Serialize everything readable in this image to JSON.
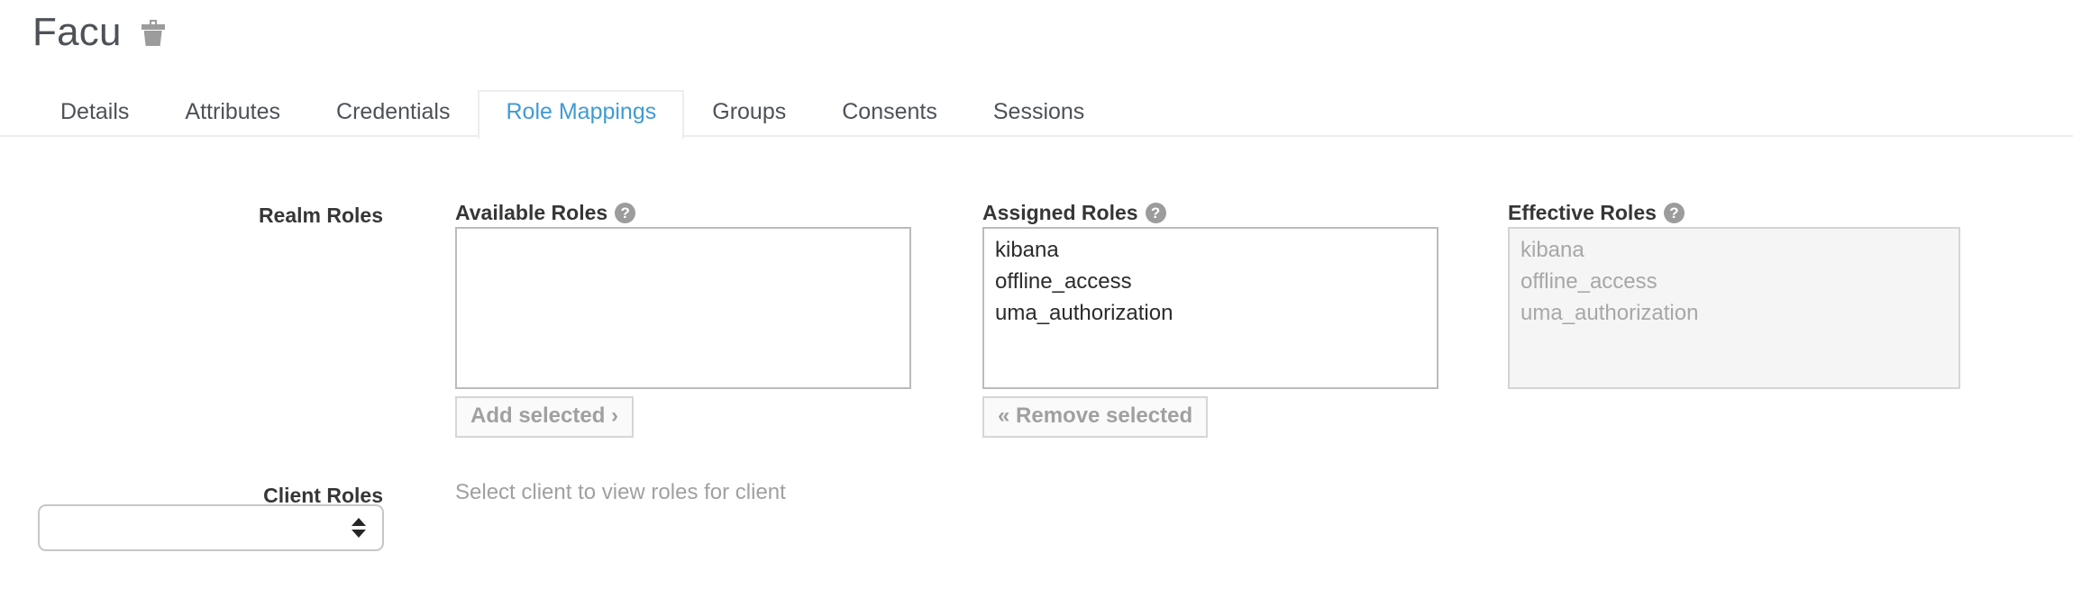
{
  "header": {
    "title": "Facu",
    "delete_icon": "trash-icon"
  },
  "tabs": [
    {
      "label": "Details",
      "active": false
    },
    {
      "label": "Attributes",
      "active": false
    },
    {
      "label": "Credentials",
      "active": false
    },
    {
      "label": "Role Mappings",
      "active": true
    },
    {
      "label": "Groups",
      "active": false
    },
    {
      "label": "Consents",
      "active": false
    },
    {
      "label": "Sessions",
      "active": false
    }
  ],
  "form": {
    "realm_roles_label": "Realm Roles",
    "client_roles_label": "Client Roles",
    "available_roles": {
      "label": "Available Roles",
      "help_icon": "help-circle-icon",
      "options": []
    },
    "assigned_roles": {
      "label": "Assigned Roles",
      "help_icon": "help-circle-icon",
      "options": [
        "kibana",
        "offline_access",
        "uma_authorization"
      ]
    },
    "effective_roles": {
      "label": "Effective Roles",
      "help_icon": "help-circle-icon",
      "disabled": true,
      "options": [
        "kibana",
        "offline_access",
        "uma_authorization"
      ]
    },
    "add_selected_button": "Add selected ›",
    "remove_selected_button": "« Remove selected",
    "client_select": {
      "value": "",
      "options": []
    },
    "client_hint": "Select client to view roles for client"
  },
  "colors": {
    "active_tab_text": "#3f9bd3",
    "body_text": "#363636",
    "muted_text": "#a0a0a0",
    "border": "#bbbbbb",
    "disabled_bg": "#f5f5f5"
  }
}
